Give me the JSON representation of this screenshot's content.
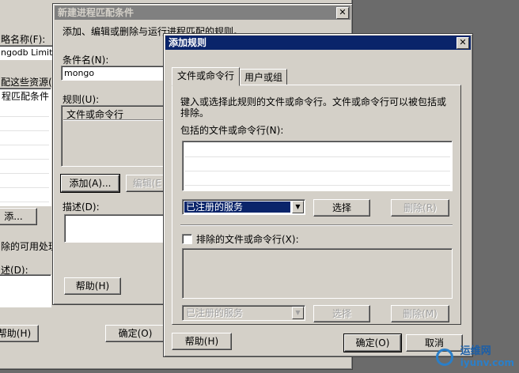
{
  "back_window": {
    "name_label": "略名称(F):",
    "name_value": "ngodb Limit",
    "resources_label": "配这些资源(I",
    "conditions_header": "程匹配条件",
    "add_button": "添...",
    "handlers_label": "除的可用处理",
    "desc_label": "述(D):",
    "help_button": "帮助(H)",
    "ok_button": "确定(O)"
  },
  "mid_window": {
    "title": "新建进程匹配条件",
    "close": "✕",
    "intro": "添加、编辑或删除与运行进程匹配的规则。",
    "condition_label": "条件名(N):",
    "condition_value": "mongo",
    "rules_label": "规则(U):",
    "rules_header": "文件或命令行",
    "add_button": "添加(A)...",
    "edit_button": "编辑(E",
    "desc_label": "描述(D):",
    "help_button": "帮助(H)"
  },
  "dialog": {
    "title": "添加规则",
    "close": "✕",
    "tabs": [
      "文件或命令行",
      "用户或组"
    ],
    "intro_line1": "键入或选择此规则的文件或命令行。文件或命令行可以被包括或",
    "intro_line2": "排除。",
    "include_label": "包括的文件或命令行(N):",
    "include_combo": "已注册的服务",
    "select_button": "选择",
    "delete_button": "删除(R)",
    "exclude_label": "排除的文件或命令行(X):",
    "exclude_combo": "已注册的服务",
    "select_button2": "选择",
    "delete_button2": "删除(M)",
    "help_button": "帮助(H)",
    "ok_button": "确定(O)",
    "cancel_button": "取消"
  },
  "watermark": {
    "brand": "运维网",
    "url": "iyunv.com"
  }
}
